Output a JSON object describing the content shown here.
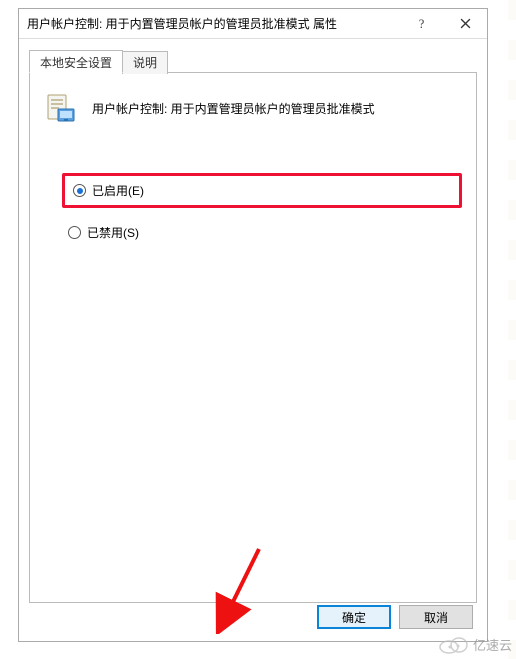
{
  "titlebar": {
    "text": "用户帐户控制: 用于内置管理员帐户的管理员批准模式 属性"
  },
  "tabs": {
    "local": "本地安全设置",
    "explain": "说明"
  },
  "policy": {
    "title": "用户帐户控制: 用于内置管理员帐户的管理员批准模式"
  },
  "options": {
    "enabled": "已启用(E)",
    "disabled": "已禁用(S)"
  },
  "buttons": {
    "ok": "确定",
    "cancel": "取消"
  },
  "watermark": {
    "text": "亿速云"
  }
}
